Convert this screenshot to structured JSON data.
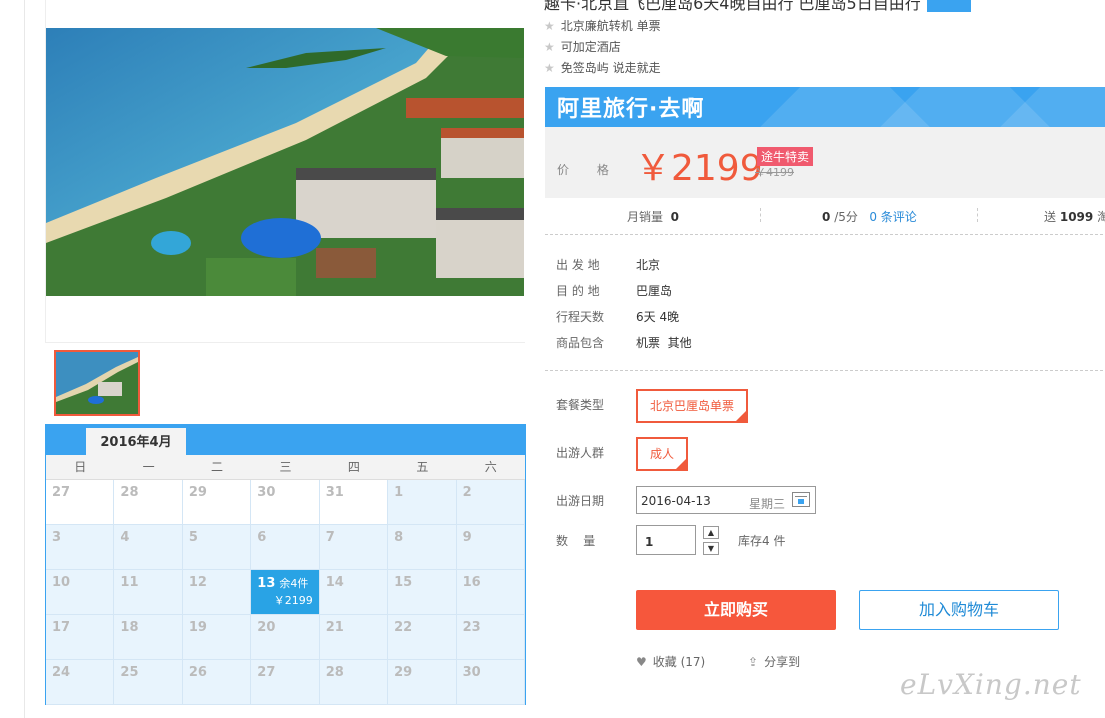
{
  "product": {
    "title": "趣卡·北京直飞巴厘岛6天4晚自由行 巴厘岛5日自由行",
    "features": [
      "北京廉航转机 单票",
      "可加定酒店",
      "免签岛屿 说走就走"
    ]
  },
  "brand": {
    "name": "阿里旅行·去啊",
    "color": "#3aa3f0"
  },
  "price": {
    "label": "价 格",
    "current": "￥2199",
    "tag": "途牛特卖",
    "original": "￥4199"
  },
  "stats": {
    "monthly_sales_label": "月销量",
    "monthly_sales": "0",
    "rating": "0",
    "rating_suffix": "/5分",
    "reviews": "0 条评论",
    "points_prefix": "送",
    "points": "1099",
    "points_suffix": "淘"
  },
  "info": [
    {
      "label": "出 发 地",
      "value": "北京"
    },
    {
      "label": "目 的 地",
      "value": "巴厘岛"
    },
    {
      "label": "行程天数",
      "value": "6天 4晚"
    },
    {
      "label": "商品包含",
      "value": "机票  其他"
    }
  ],
  "options": {
    "package_label": "套餐类型",
    "package_value": "北京巴厘岛单票",
    "traveler_label": "出游人群",
    "traveler_value": "成人",
    "date_label": "出游日期",
    "date_value": "2016-04-13",
    "date_weekday": "星期三",
    "qty_label": "数    量",
    "qty_value": "1",
    "stock_text": "库存4 件"
  },
  "actions": {
    "buy": "立即购买",
    "cart": "加入购物车",
    "favorite": "收藏 (17)",
    "share": "分享到"
  },
  "calendar": {
    "month": "2016年4月",
    "weekdays": [
      "日",
      "一",
      "二",
      "三",
      "四",
      "五",
      "六"
    ],
    "days": [
      [
        "27",
        "28",
        "29",
        "30",
        "31",
        "1",
        "2"
      ],
      [
        "3",
        "4",
        "5",
        "6",
        "7",
        "8",
        "9"
      ],
      [
        "10",
        "11",
        "12",
        "13",
        "14",
        "15",
        "16"
      ],
      [
        "17",
        "18",
        "19",
        "20",
        "21",
        "22",
        "23"
      ],
      [
        "24",
        "25",
        "26",
        "27",
        "28",
        "29",
        "30"
      ]
    ],
    "selected": {
      "day": "13",
      "stock": "余4件",
      "price": "￥2199"
    }
  },
  "watermark": "eLvXing.net"
}
